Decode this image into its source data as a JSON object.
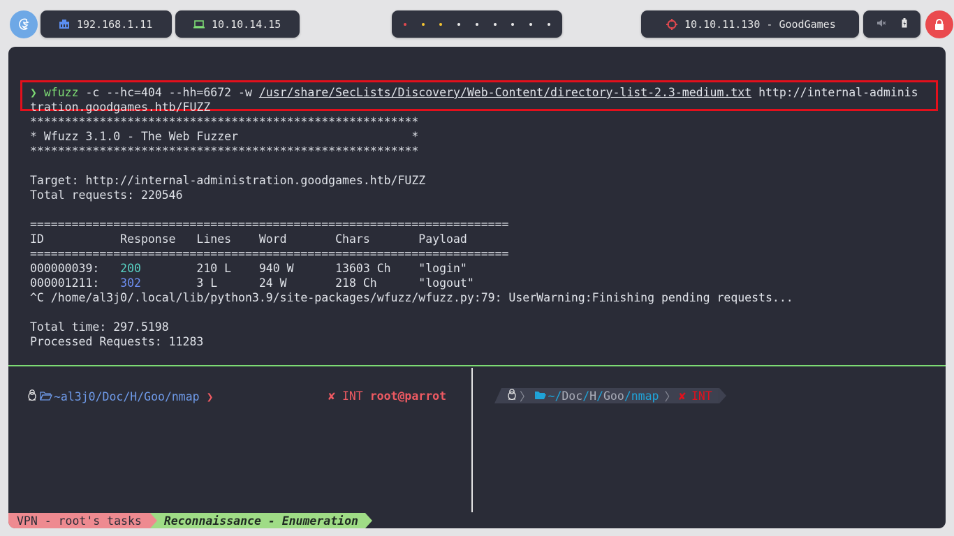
{
  "topbar": {
    "local_ip": "192.168.1.11",
    "vpn_ip": "10.10.14.15",
    "target": "10.10.11.130 - GoodGames"
  },
  "terminal": {
    "prompt_symbol": "❯",
    "cmd": "wfuzz",
    "cmd_args": " -c --hc=404 --hh=6672 -w ",
    "cmd_path": "/usr/share/SecLists/Discovery/Web-Content/directory-list-2.3-medium.txt",
    "cmd_url_a": " http://internal-adminis",
    "cmd_url_b": "tration.goodgames.htb/FUZZ",
    "stars": "********************************************************",
    "banner": "* Wfuzz 3.1.0 - The Web Fuzzer                         *",
    "target_line": "Target: http://internal-administration.goodgames.htb/FUZZ",
    "total_req": "Total requests: 220546",
    "rule": "=====================================================================",
    "header": "ID           Response   Lines    Word       Chars       Payload",
    "rows": [
      {
        "id": "000000039:   ",
        "code": "200",
        "rest": "        210 L    940 W      13603 Ch    \"login\""
      },
      {
        "id": "000001211:   ",
        "code": "302",
        "rest": "        3 L      24 W       218 Ch      \"logout\""
      }
    ],
    "warning": "^C /home/al3j0/.local/lib/python3.9/site-packages/wfuzz/wfuzz.py:79: UserWarning:Finishing pending requests...",
    "total_time": "Total time: 297.5198",
    "processed": "Processed Requests: 11283"
  },
  "left_prompt": {
    "path": "~al3j0/Doc/H/Goo/nmap",
    "arrow": "❯",
    "status_mark": "✘",
    "status_text": "INT",
    "user": "root@parrot"
  },
  "right_prompt": {
    "tilde": "~",
    "p1": "Doc",
    "p2": "H",
    "p3": "Goo",
    "p4": "nmap",
    "status_mark": "✘",
    "status_text": "INT",
    "slash": "/"
  },
  "statusbar": {
    "session": "VPN - root's tasks",
    "window": "Reconnaissance - Enumeration"
  }
}
